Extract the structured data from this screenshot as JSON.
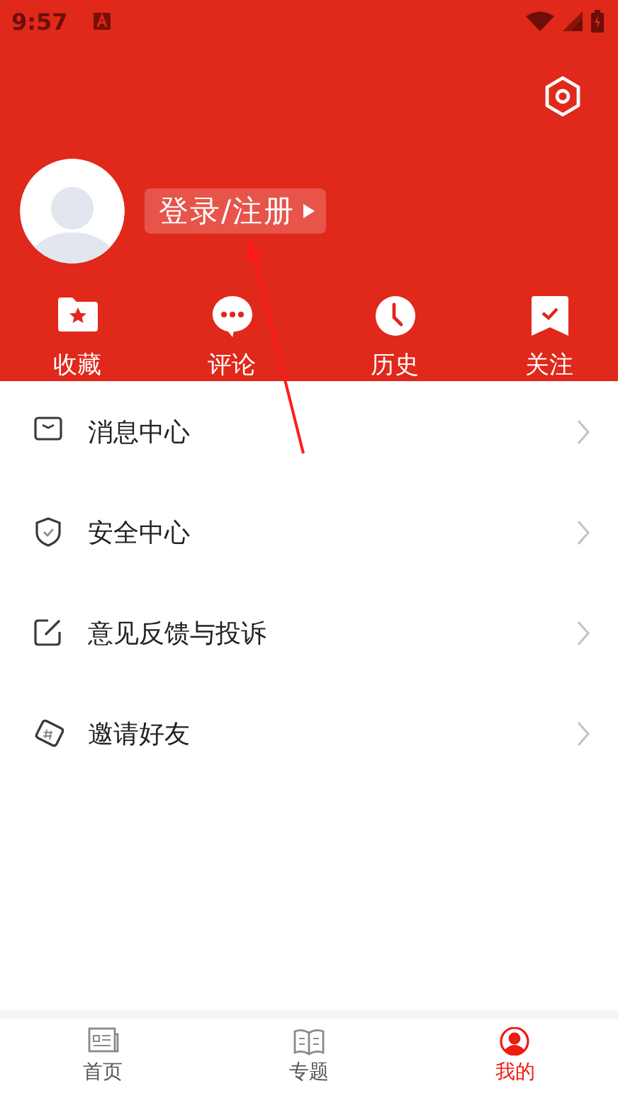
{
  "status_bar": {
    "time": "9:57"
  },
  "profile": {
    "login_label": "登录/注册"
  },
  "quick_actions": [
    {
      "label": "收藏"
    },
    {
      "label": "评论"
    },
    {
      "label": "历史"
    },
    {
      "label": "关注"
    }
  ],
  "menu": [
    {
      "label": "消息中心"
    },
    {
      "label": "安全中心"
    },
    {
      "label": "意见反馈与投诉"
    },
    {
      "label": "邀请好友"
    }
  ],
  "tabs": [
    {
      "label": "首页",
      "selected": false
    },
    {
      "label": "专题",
      "selected": false
    },
    {
      "label": "我的",
      "selected": true
    }
  ]
}
